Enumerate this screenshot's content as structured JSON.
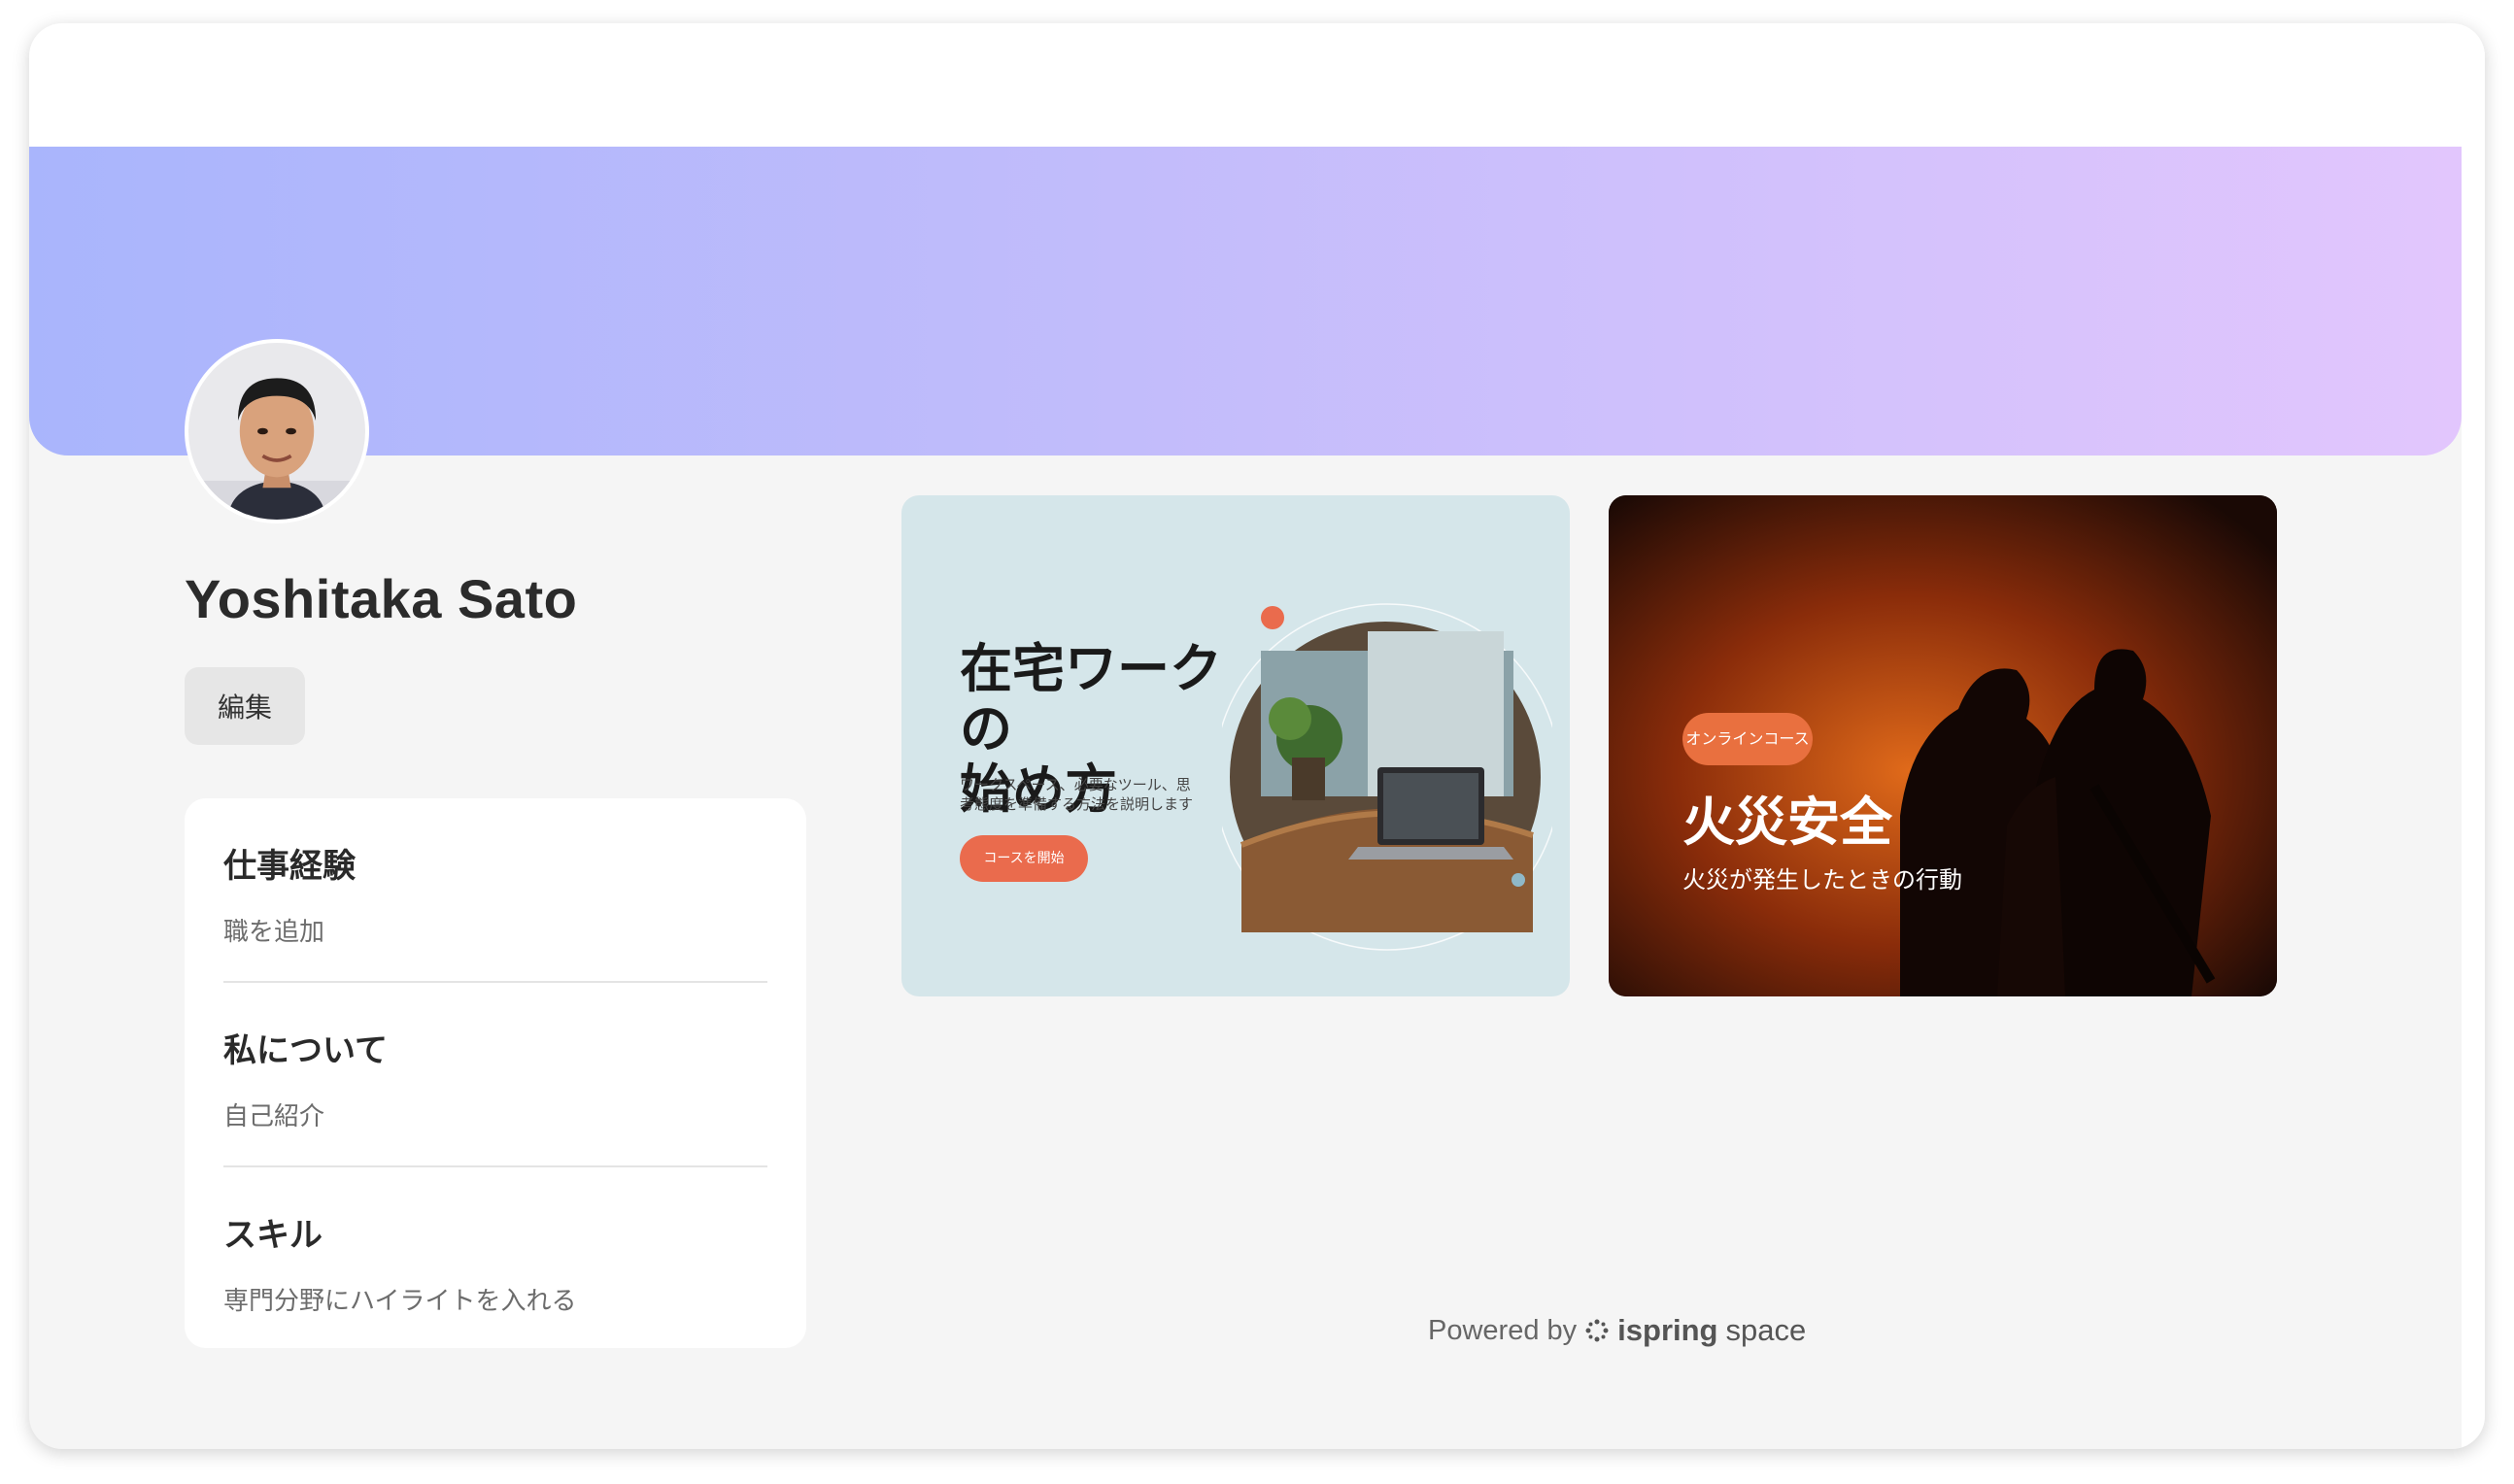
{
  "profile": {
    "name": "Yoshitaka Sato",
    "edit_label": "編集"
  },
  "info": {
    "work": {
      "title": "仕事経験",
      "sub": "職を追加"
    },
    "about": {
      "title": "私について",
      "sub": "自己紹介"
    },
    "skills": {
      "title": "スキル",
      "sub": "専門分野にハイライトを入れる"
    }
  },
  "courses": [
    {
      "title_line1": "在宅ワークの",
      "title_line2": "始め方",
      "desc": "ワークスペース、必要なツール、思考態度を準備する方法を説明します",
      "button": "コースを開始"
    },
    {
      "badge": "オンラインコース",
      "title": "火災安全",
      "sub": "火災が発生したときの行動"
    }
  ],
  "footer": {
    "powered_by": "Powered by",
    "brand_bold": "ispring",
    "brand_light": "space"
  },
  "colors": {
    "banner_start": "#a9b5fc",
    "banner_end": "#e2c6fd",
    "accent_orange": "#ea6b4d"
  }
}
